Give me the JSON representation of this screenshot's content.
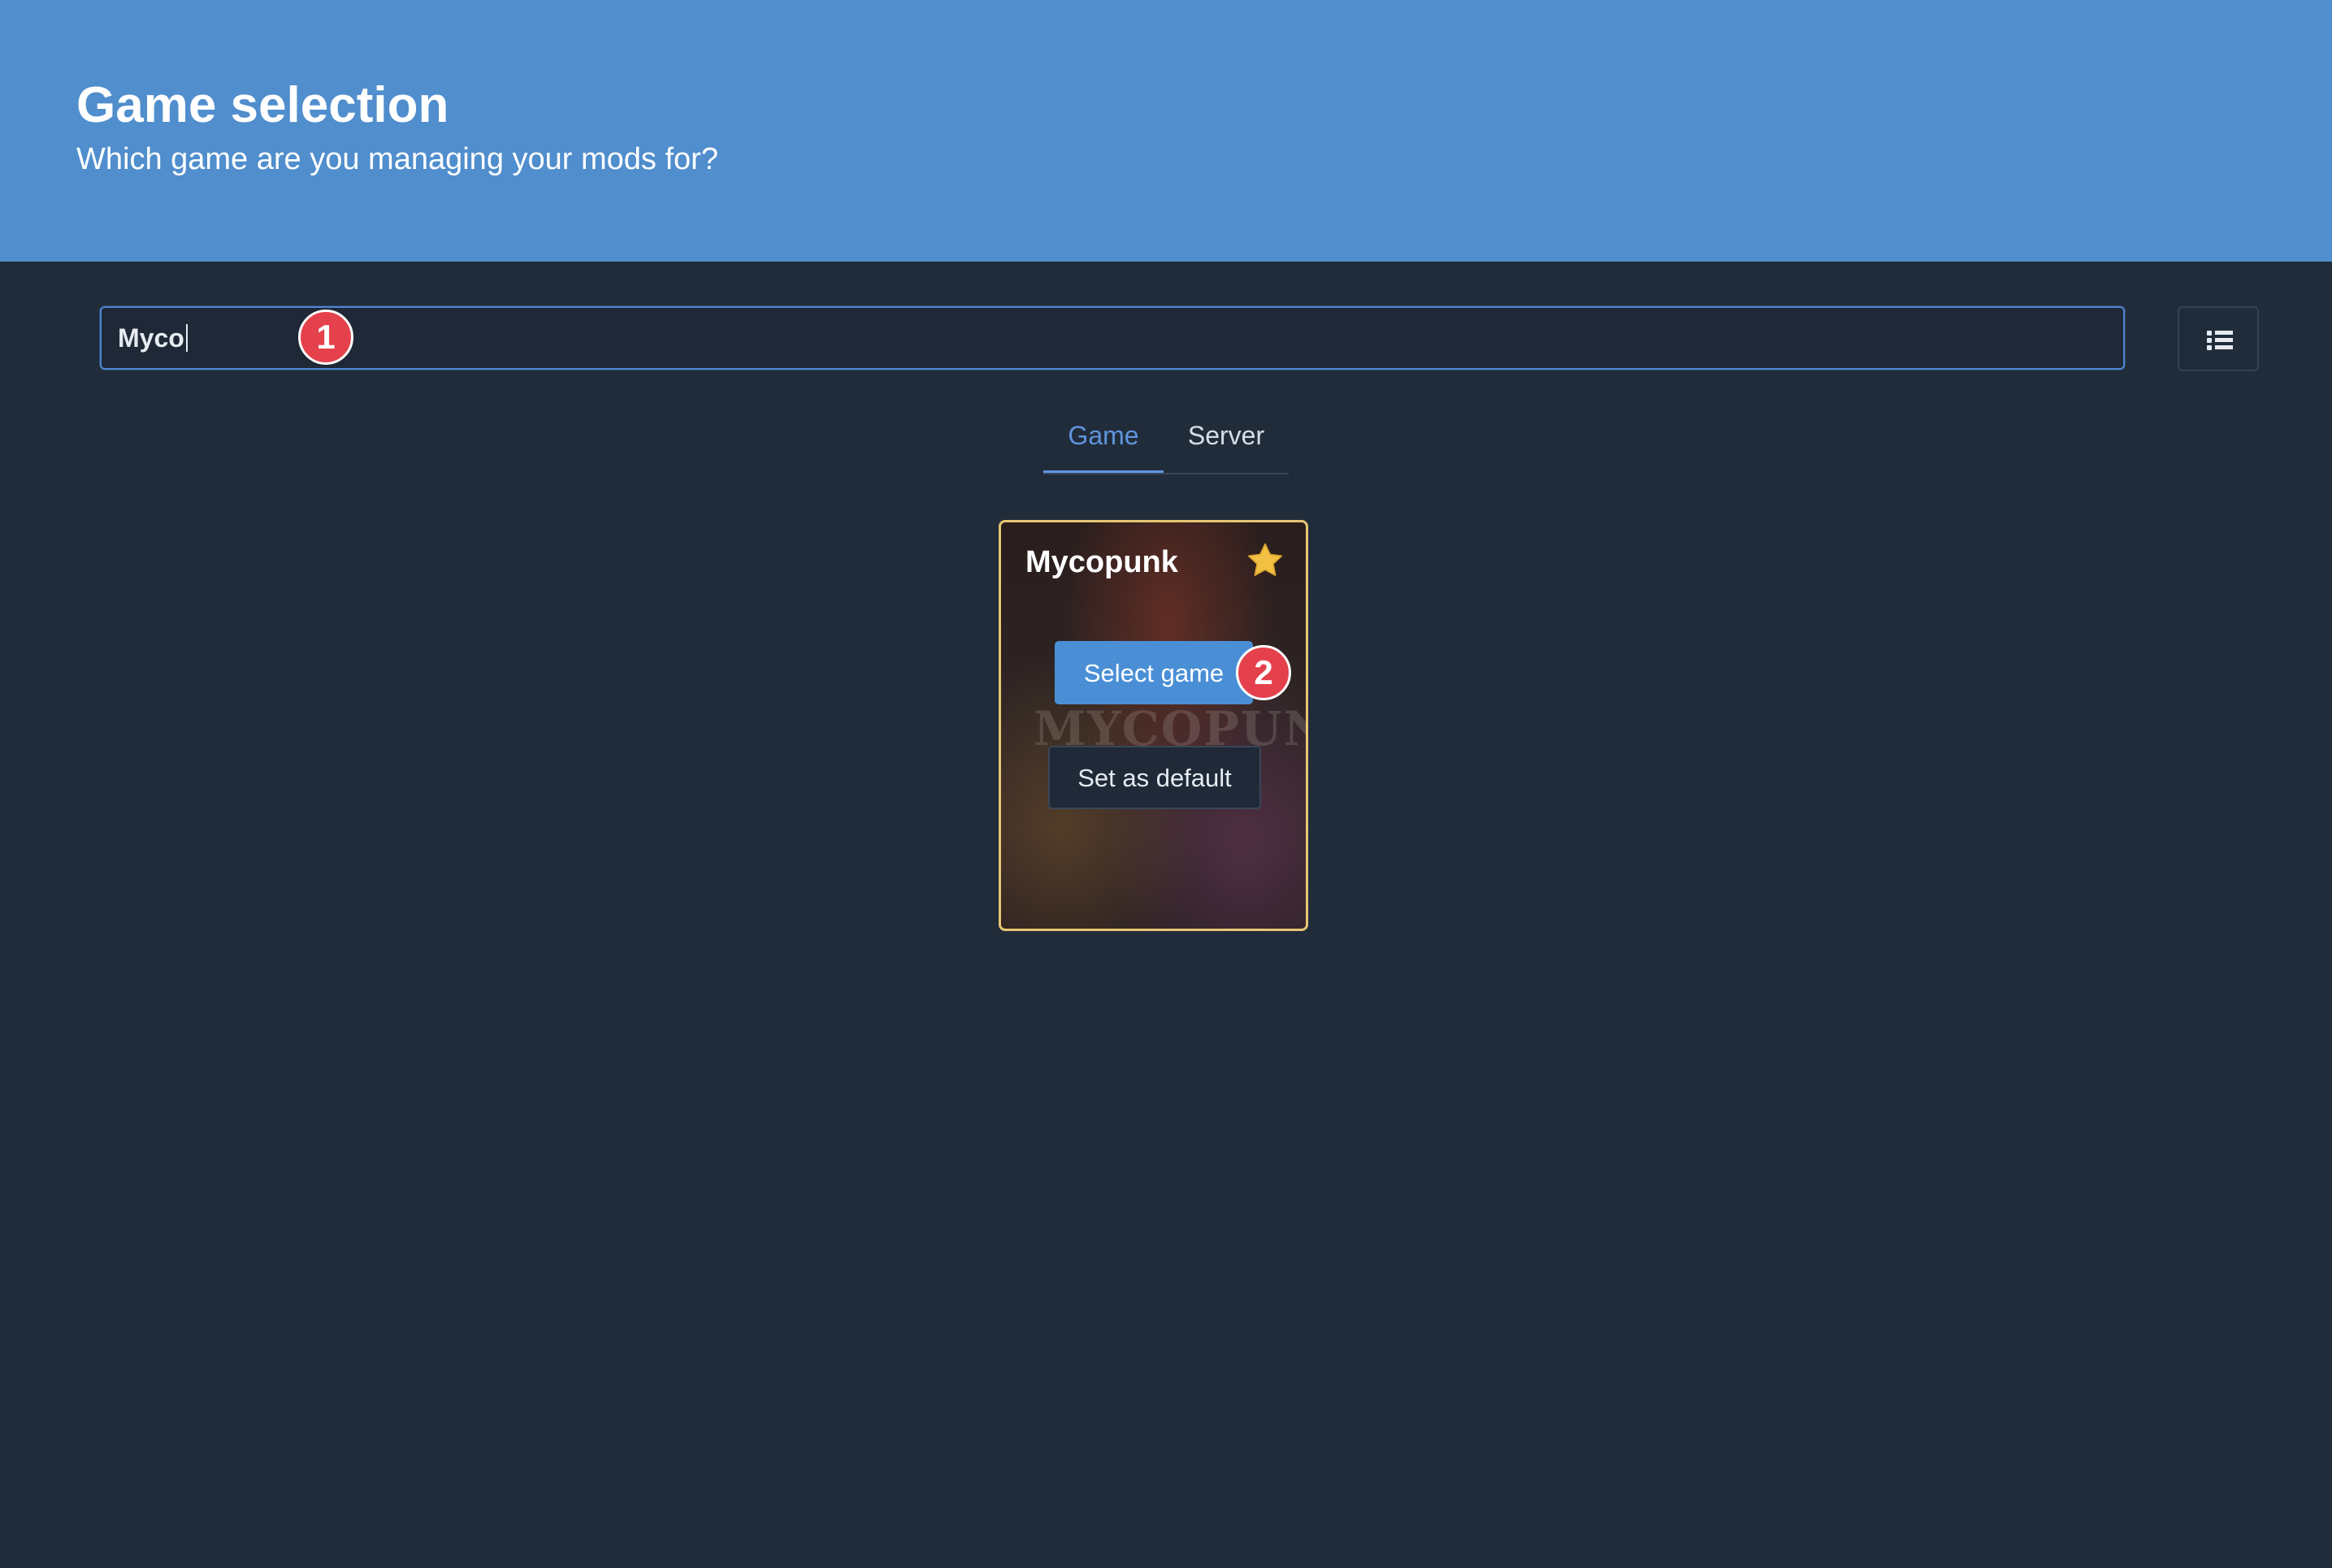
{
  "header": {
    "title": "Game selection",
    "subtitle": "Which game are you managing your mods for?",
    "background_color": "#508ecd"
  },
  "search": {
    "value": "Myco",
    "focused": true
  },
  "view_toggle": {
    "icon": "list-icon"
  },
  "tabs": [
    {
      "label": "Game",
      "active": true
    },
    {
      "label": "Server",
      "active": false
    }
  ],
  "games": [
    {
      "title": "Mycopunk",
      "art_text": "MYCOPUNK",
      "favorite": true,
      "favorite_icon": "star-icon",
      "select_label": "Select game",
      "default_label": "Set as default"
    }
  ],
  "annotations": {
    "marker_1": "1",
    "marker_2": "2",
    "marker_color": "#e5414d"
  },
  "colors": {
    "page_background": "#212c3b",
    "accent": "#5f95dc",
    "primary_button": "#4a8fd6",
    "card_border": "#e6c673",
    "star": "#f2c144"
  }
}
